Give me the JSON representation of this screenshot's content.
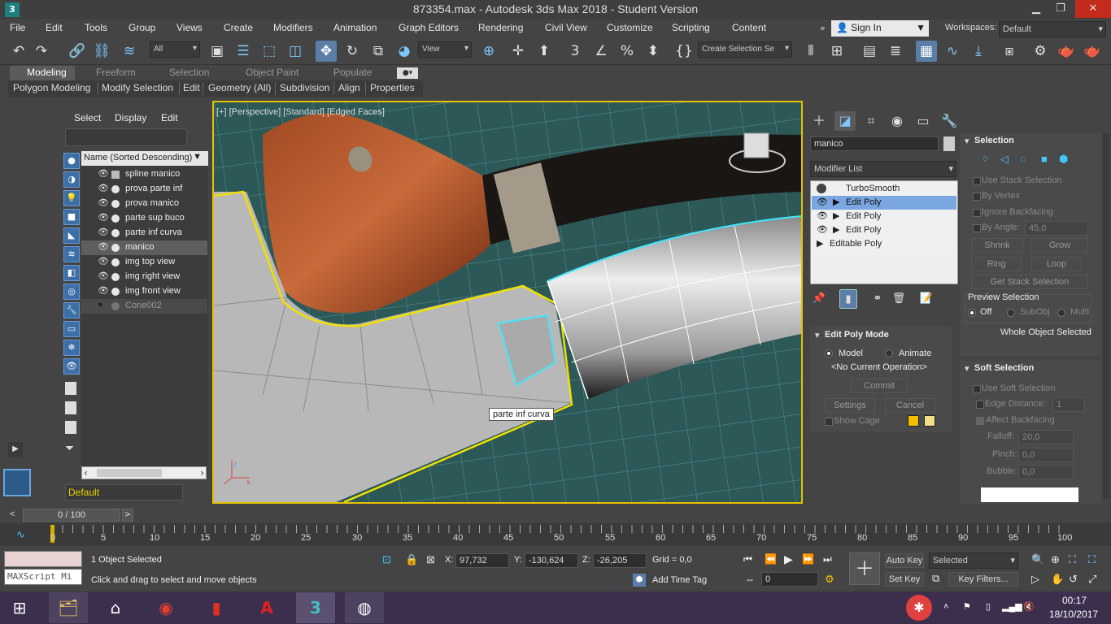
{
  "title": "873354.max - Autodesk 3ds Max 2018 - Student Version",
  "menu": [
    "File",
    "Edit",
    "Tools",
    "Group",
    "Views",
    "Create",
    "Modifiers",
    "Animation",
    "Graph Editors",
    "Rendering",
    "Civil View",
    "Customize",
    "Scripting",
    "Content"
  ],
  "account": {
    "sign_in": "Sign In",
    "workspaces_label": "Workspaces:",
    "workspace": "Default"
  },
  "toolbar": {
    "filter": "All",
    "ref_coord": "View",
    "selection_set": "Create Selection Se"
  },
  "ribbon": {
    "tabs": [
      "Modeling",
      "Freeform",
      "Selection",
      "Object Paint",
      "Populate"
    ],
    "subtabs": [
      "Polygon Modeling",
      "Modify Selection",
      "Edit",
      "Geometry (All)",
      "Subdivision",
      "Align",
      "Properties"
    ]
  },
  "scene": {
    "tabs": [
      "Select",
      "Display",
      "Edit"
    ],
    "column": "Name (Sorted Descending)",
    "items": [
      "spline manico",
      "prova parte inf",
      "prova manico",
      "parte sup buco",
      "parte inf curva",
      "manico",
      "img top view",
      "img right view",
      "img front view",
      "Cone002"
    ],
    "layer": "Default"
  },
  "viewport": {
    "label": "[+] [Perspective] [Standard] [Edged Faces]",
    "tooltip": "parte inf curva"
  },
  "modify": {
    "object_name": "manico",
    "modifier_list": "Modifier List",
    "stack": [
      "TurboSmooth",
      "Edit Poly",
      "Edit Poly",
      "Edit Poly",
      "Editable Poly"
    ]
  },
  "edit_poly_mode": {
    "title": "Edit Poly Mode",
    "model": "Model",
    "animate": "Animate",
    "operation": "<No Current Operation>",
    "commit": "Commit",
    "settings": "Settings",
    "cancel": "Cancel",
    "show_cage": "Show Cage"
  },
  "selection": {
    "title": "Selection",
    "use_stack": "Use Stack Selection",
    "by_vertex": "By Vertex",
    "ignore_backfacing": "Ignore Backfacing",
    "by_angle": "By Angle:",
    "angle_value": "45,0",
    "shrink": "Shrink",
    "grow": "Grow",
    "ring": "Ring",
    "loop": "Loop",
    "get_stack": "Get Stack Selection",
    "preview_title": "Preview Selection",
    "preview_off": "Off",
    "preview_subobj": "SubObj",
    "preview_multi": "Multi",
    "status": "Whole Object Selected"
  },
  "soft_selection": {
    "title": "Soft Selection",
    "use_soft": "Use Soft Selection",
    "edge_distance": "Edge Distance:",
    "edge_value": "1",
    "affect_backfacing": "Affect Backfacing",
    "falloff": "Falloff:",
    "falloff_value": "20,0",
    "pinch": "Pinch:",
    "pinch_value": "0,0",
    "bubble": "Bubble:",
    "bubble_value": "0,0"
  },
  "timeline": {
    "frame": "0 / 100",
    "ticks": [
      "0",
      "5",
      "10",
      "15",
      "20",
      "25",
      "30",
      "35",
      "40",
      "45",
      "50",
      "55",
      "60",
      "65",
      "70",
      "75",
      "80",
      "85",
      "90",
      "95",
      "100"
    ]
  },
  "status": {
    "maxscript": "MAXScript Mi",
    "selected": "1 Object Selected",
    "hint": "Click and drag to select and move objects",
    "x_label": "X:",
    "x": "97,732",
    "y_label": "Y:",
    "y": "-130,624",
    "z_label": "Z:",
    "z": "-26,205",
    "grid": "Grid = 0,0",
    "add_time_tag": "Add Time Tag",
    "auto_key": "Auto Key",
    "set_key": "Set Key",
    "key_mode": "Selected",
    "key_filters": "Key Filters...",
    "frame_value": "0"
  },
  "taskbar": {
    "time": "00:17",
    "date": "18/10/2017"
  },
  "colors": {
    "accent": "#5b7ea6",
    "selection_yellow": "#e8e000",
    "selection_cyan": "#40e0ff"
  }
}
